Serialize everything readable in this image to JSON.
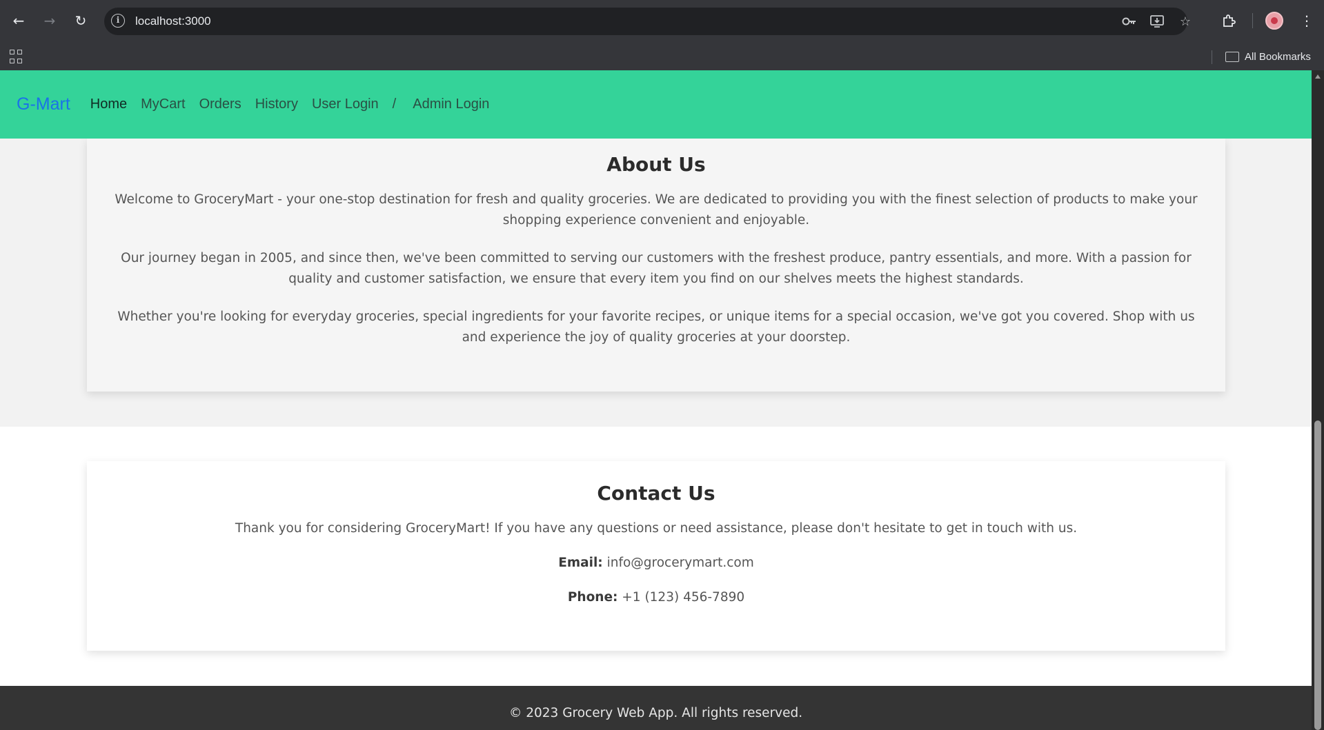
{
  "browser": {
    "url": "localhost:3000",
    "bookmarks_folder": "All Bookmarks",
    "icons": {
      "back": "arrow-left-icon",
      "forward": "arrow-right-icon",
      "reload": "reload-icon",
      "site_info": "info-icon",
      "password": "key-icon",
      "install": "install-app-icon",
      "bookmark": "star-icon",
      "extensions": "puzzle-icon",
      "menu": "more-vertical-icon",
      "apps": "apps-grid-icon",
      "folder": "folder-icon"
    }
  },
  "navbar": {
    "brand": "G-Mart",
    "links": [
      "Home",
      "MyCart",
      "Orders",
      "History",
      "User Login"
    ],
    "separator": "/",
    "admin_link": "Admin Login",
    "active": "Home",
    "color": "#34d399",
    "brand_color": "#1a73e8"
  },
  "about": {
    "title": "About Us",
    "paragraphs": [
      "Welcome to GroceryMart - your one-stop destination for fresh and quality groceries. We are dedicated to providing you with the finest selection of products to make your shopping experience convenient and enjoyable.",
      "Our journey began in 2005, and since then, we've been committed to serving our customers with the freshest produce, pantry essentials, and more. With a passion for quality and customer satisfaction, we ensure that every item you find on our shelves meets the highest standards.",
      "Whether you're looking for everyday groceries, special ingredients for your favorite recipes, or unique items for a special occasion, we've got you covered. Shop with us and experience the joy of quality groceries at your doorstep."
    ]
  },
  "contact": {
    "title": "Contact Us",
    "intro": "Thank you for considering GroceryMart! If you have any questions or need assistance, please don't hesitate to get in touch with us.",
    "email_label": "Email:",
    "email_value": "info@grocerymart.com",
    "phone_label": "Phone:",
    "phone_value": "+1 (123) 456-7890"
  },
  "footer": {
    "text": "© 2023 Grocery Web App. All rights reserved."
  }
}
